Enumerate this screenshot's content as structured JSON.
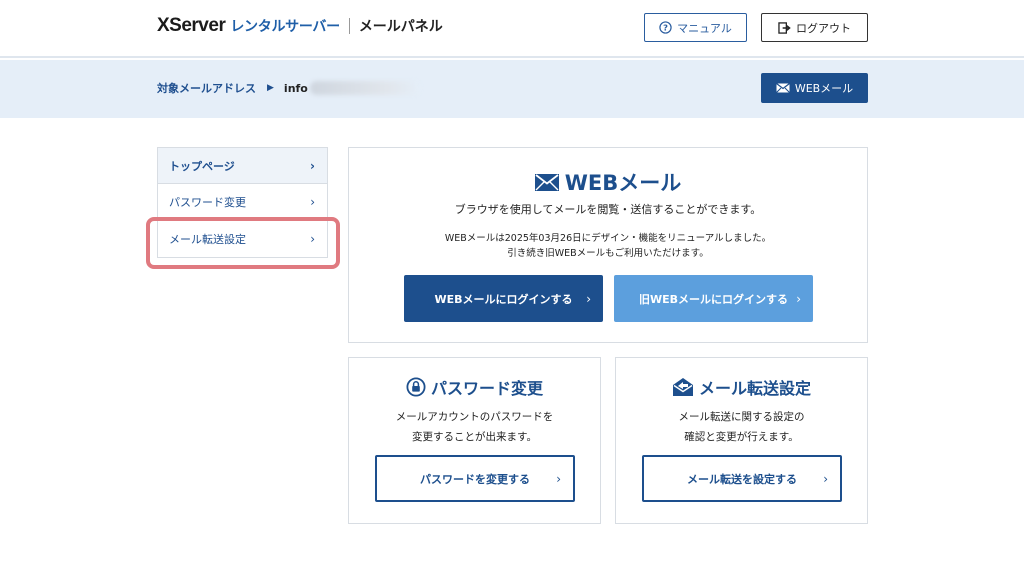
{
  "header": {
    "logo_brand": "XServer",
    "logo_product": "レンタルサーバー",
    "panel_name": "メールパネル",
    "manual_label": "マニュアル",
    "logout_label": "ログアウト"
  },
  "band": {
    "target_label": "対象メールアドレス",
    "address": "info",
    "webmail_label": "WEBメール"
  },
  "sidebar": {
    "items": [
      {
        "label": "トップページ"
      },
      {
        "label": "パスワード変更"
      },
      {
        "label": "メール転送設定"
      }
    ]
  },
  "webmail_card": {
    "title": "WEBメール",
    "description": "ブラウザを使用してメールを閲覧・送信することができます。",
    "note_line1": "WEBメールは2025年03月26日にデザイン・機能をリニューアルしました。",
    "note_line2": "引き続き旧WEBメールもご利用いただけます。",
    "login_label": "WEBメールにログインする",
    "old_login_label": "旧WEBメールにログインする"
  },
  "password_card": {
    "title": "パスワード変更",
    "desc_line1": "メールアカウントのパスワードを",
    "desc_line2": "変更することが出来ます。",
    "button_label": "パスワードを変更する"
  },
  "forward_card": {
    "title": "メール転送設定",
    "desc_line1": "メール転送に関する設定の",
    "desc_line2": "確認と変更が行えます。",
    "button_label": "メール転送を設定する"
  },
  "colors": {
    "primary": "#1d4f8d",
    "secondary_button": "#5c9fdd",
    "band": "#e5eef8",
    "highlight": "#e07a80"
  },
  "icons": {
    "manual": "question-circle-icon",
    "logout": "logout-icon",
    "webmail": "envelope-icon",
    "password": "lock-icon",
    "forward": "mail-forward-icon",
    "chevron": "chevron-right-icon",
    "breadcrumb": "triangle-right-icon"
  }
}
